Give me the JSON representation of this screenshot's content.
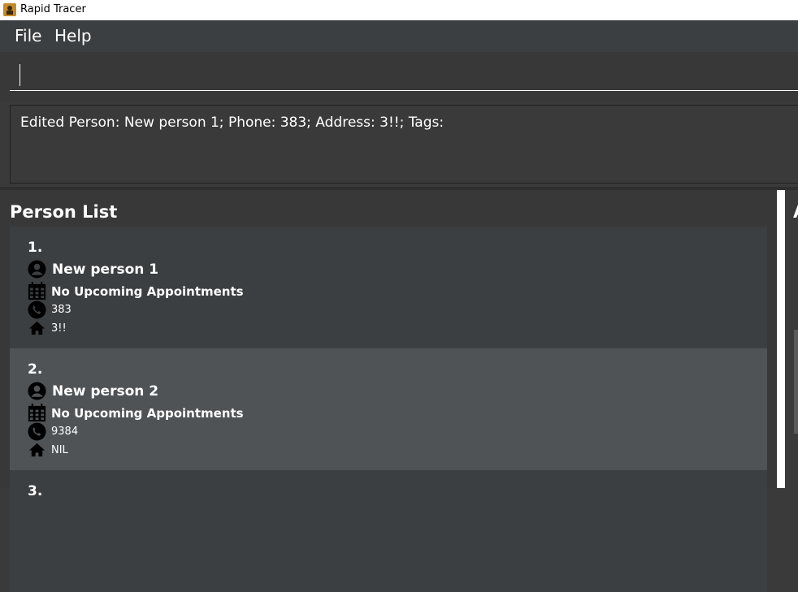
{
  "window": {
    "title": "Rapid Tracer",
    "icon": "app-icon"
  },
  "menu": {
    "file_label": "File",
    "help_label": "Help"
  },
  "command": {
    "value": ""
  },
  "result": {
    "text": "Edited Person: New person 1; Phone: 383; Address: 3!!; Tags:"
  },
  "person_list": {
    "title": "Person List",
    "persons": [
      {
        "index": "1.",
        "name": "New person 1",
        "appointment": "No Upcoming Appointments",
        "phone": "383",
        "address": "3!!",
        "selected": false
      },
      {
        "index": "2.",
        "name": "New person 2",
        "appointment": "No Upcoming Appointments",
        "phone": "9384",
        "address": "NIL",
        "selected": true
      },
      {
        "index": "3."
      }
    ]
  },
  "right_panel": {
    "title_glyph": "A"
  },
  "colors": {
    "background": "#3a3a3a",
    "card": "#3c3f41",
    "card_selected": "#4f5356",
    "text": "#ffffff",
    "icon": "#000000"
  }
}
